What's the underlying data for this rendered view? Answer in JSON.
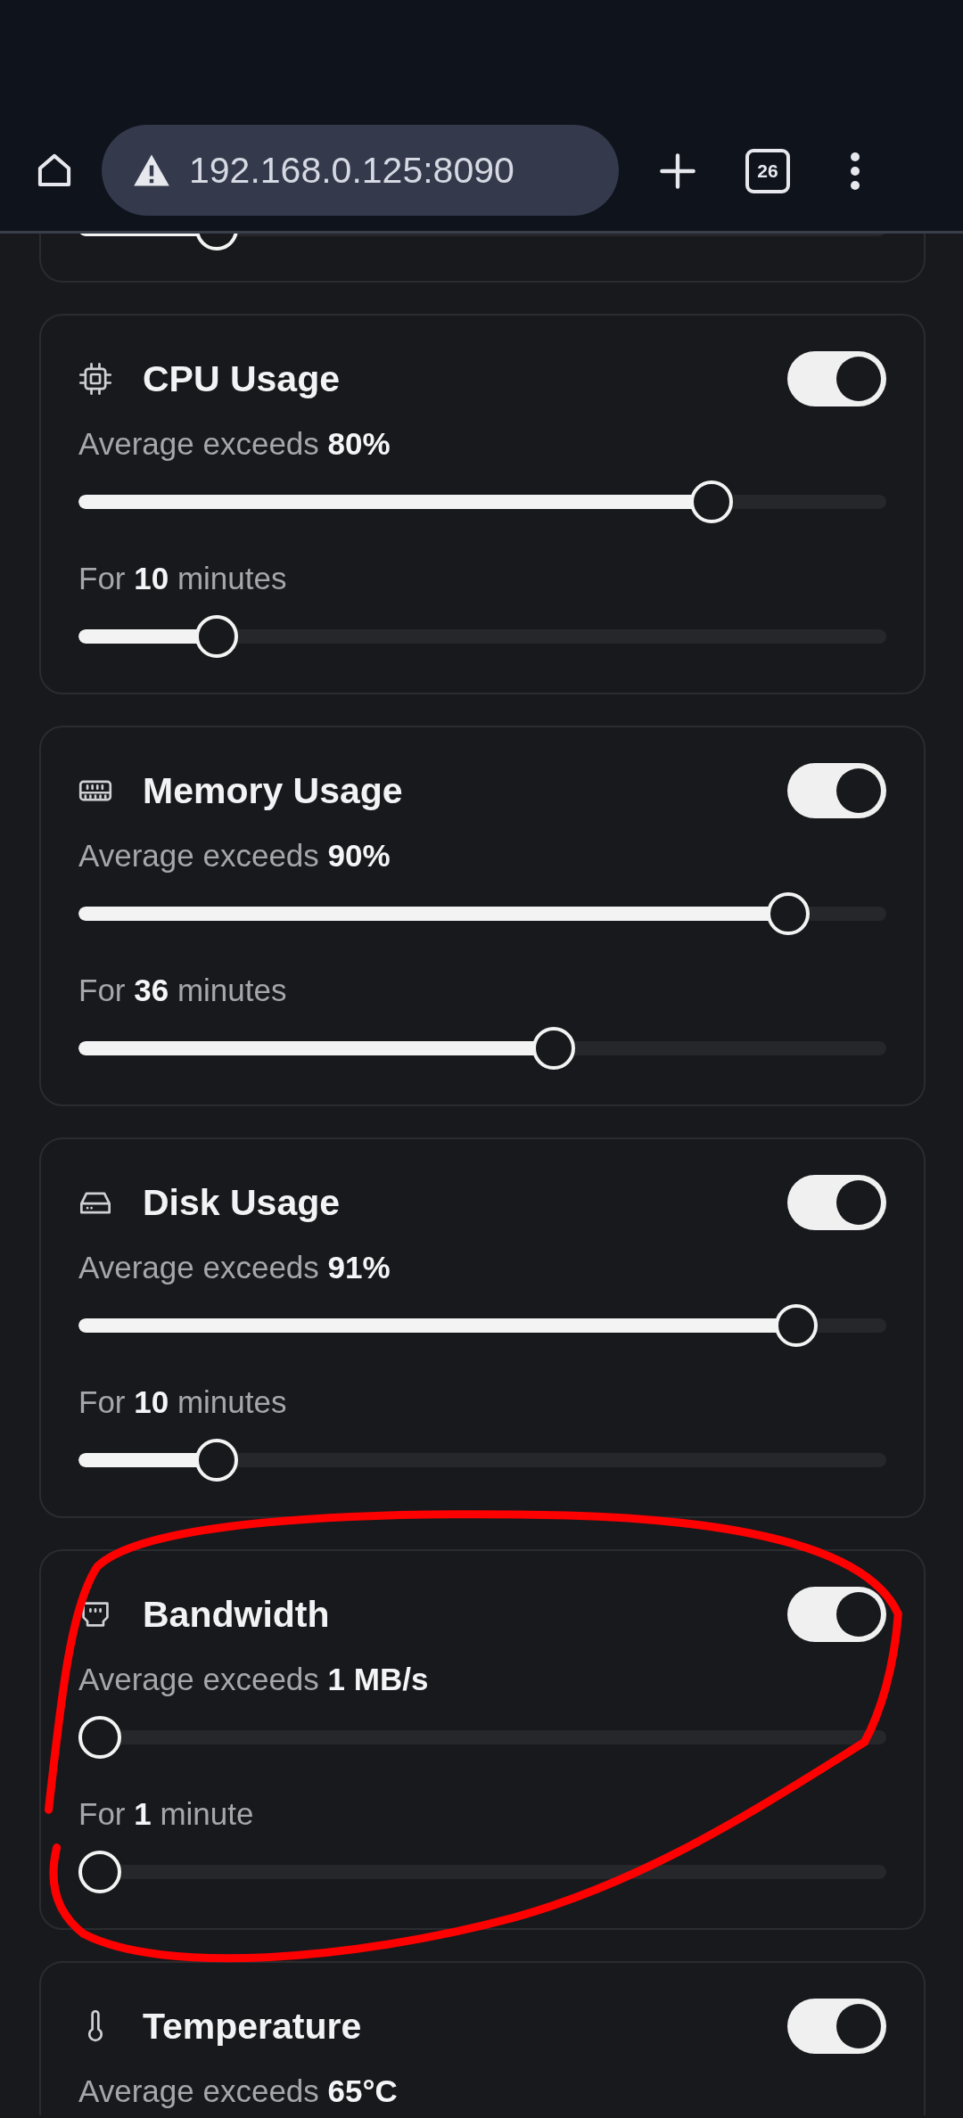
{
  "browser": {
    "address": "192.168.0.125:8090",
    "tab_count": "26"
  },
  "cards": [
    {
      "duration": {
        "level": 0.153
      }
    },
    {
      "kind": "cpu",
      "title": "CPU Usage",
      "enabled": true,
      "threshold": {
        "label": "Average exceeds **80%**",
        "level": 0.8
      },
      "duration": {
        "label": "For **10** minutes",
        "level": 0.153
      }
    },
    {
      "kind": "memory",
      "title": "Memory Usage",
      "enabled": true,
      "threshold": {
        "label": "Average exceeds **90%**",
        "level": 0.9
      },
      "duration": {
        "label": "For **36** minutes",
        "level": 0.593
      }
    },
    {
      "kind": "disk",
      "title": "Disk Usage",
      "enabled": true,
      "threshold": {
        "label": "Average exceeds **91%**",
        "level": 0.91
      },
      "duration": {
        "label": "For **10** minutes",
        "level": 0.153
      }
    },
    {
      "kind": "network",
      "title": "Bandwidth",
      "enabled": true,
      "threshold": {
        "label": "Average exceeds **1 MB/s**",
        "level": 0
      },
      "duration": {
        "label": "For **1** minute",
        "level": 0
      }
    },
    {
      "kind": "thermometer",
      "title": "Temperature",
      "enabled": true,
      "threshold": {
        "label": "Average exceeds **65°C**"
      }
    }
  ],
  "annotation": {
    "kind": "freehand-circle"
  }
}
